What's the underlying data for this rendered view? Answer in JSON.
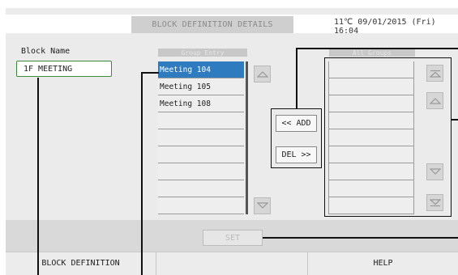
{
  "header": {
    "title": "BLOCK DEFINITION DETAILS",
    "datetime": "11℃ 09/01/2015 (Fri) 16:04"
  },
  "block": {
    "label": "Block Name",
    "value": "1F MEETING"
  },
  "group_entry": {
    "header": "Group Entry",
    "rows": [
      "Meeting 104",
      "Meeting 105",
      "Meeting 108",
      "",
      "",
      "",
      "",
      "",
      ""
    ],
    "selected_index": 0
  },
  "all_groups": {
    "header": "All Groups",
    "rows": [
      "",
      "",
      "",
      "",
      "",
      "",
      "",
      "",
      ""
    ]
  },
  "actions": {
    "add_label": "<< ADD",
    "del_label": "DEL >>",
    "set_label": "SET"
  },
  "footer": {
    "left_label": "BLOCK DEFINITION",
    "right_label": "HELP"
  },
  "colors": {
    "selection": "#2e7bbf",
    "field_border": "#3a8a3a",
    "highlight_frame": "#111111"
  },
  "icons": [
    "scroll-up-icon",
    "scroll-down-icon",
    "scroll-top-icon",
    "scroll-bottom-icon"
  ]
}
